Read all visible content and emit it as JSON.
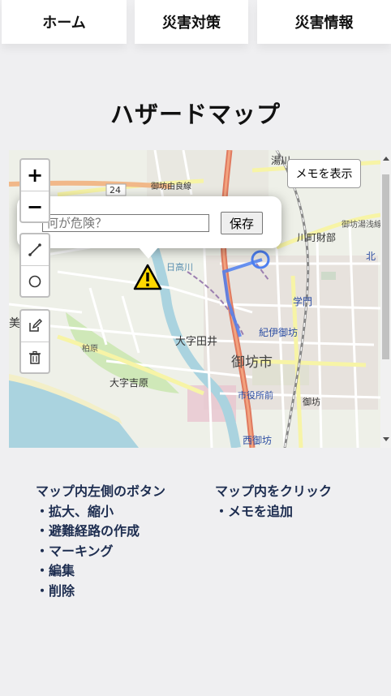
{
  "nav": {
    "items": [
      {
        "label": "ホーム"
      },
      {
        "label": "災害対策"
      },
      {
        "label": "災害情報"
      }
    ]
  },
  "page_title": "ハザードマップ",
  "map": {
    "zoom_in_label": "+",
    "zoom_out_label": "−",
    "memo_toggle_label": "メモを表示",
    "popup": {
      "input_placeholder": "何が危険？",
      "input_value": "",
      "save_label": "保存"
    },
    "tools": [
      "polyline-icon",
      "circle-icon",
      "edit-icon",
      "trash-icon"
    ],
    "marker_icon": "warning-icon",
    "place_labels": {
      "route24": "24",
      "mibo_ikaryodo": "御坊由良線",
      "yukawa_shinaru": "湯川",
      "ikawacho": "川町財部",
      "mibo_yuasa": "御坊湯浅線",
      "kimon": "学門",
      "kiigobo": "紀伊御坊",
      "oaza_tai": "大字田井",
      "gobo_city": "御坊市",
      "oaza_yoshihara": "大字吉原",
      "shiyakushomae": "市役所前",
      "gobo": "御坊",
      "nishigobo": "西御坊",
      "hidaka_river": "日高川",
      "kashiwa": "柏原",
      "mi": "美",
      "kitai": "北"
    }
  },
  "help": {
    "left_heading": "マップ内左側のボタン",
    "left_items": [
      "・拡大、縮小",
      "・避難経路の作成",
      "・マーキング",
      "・編集",
      "・削除"
    ],
    "right_heading": "マップ内をクリック",
    "right_items": [
      "・メモを追加"
    ]
  }
}
